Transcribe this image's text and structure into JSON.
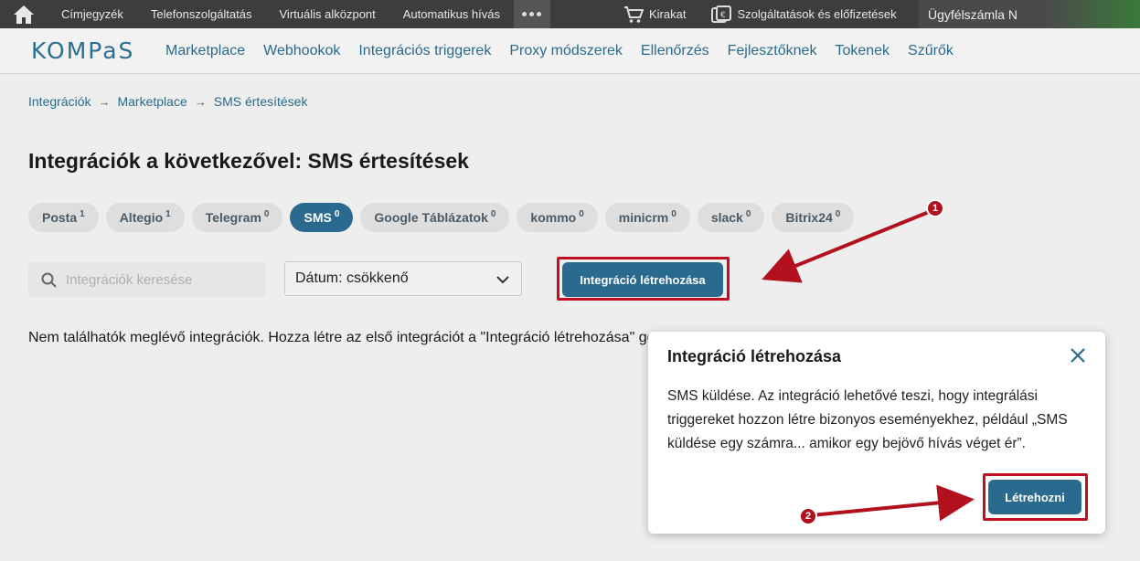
{
  "topbar": {
    "home_icon": "home-icon",
    "items": [
      "Címjegyzék",
      "Telefonszolgáltatás",
      "Virtuális alközpont",
      "Automatikus hívás"
    ],
    "cart_label": "Kirakat",
    "services_label": "Szolgáltatások és előfizetések",
    "account_label": "Ügyfélszámla N"
  },
  "navbar": {
    "logo": "KOMPaS",
    "links": [
      "Marketplace",
      "Webhookok",
      "Integrációs triggerek",
      "Proxy módszerek",
      "Ellenőrzés",
      "Fejlesztőknek",
      "Tokenek",
      "Szűrők"
    ]
  },
  "breadcrumb": [
    "Integrációk",
    "Marketplace",
    "SMS értesítések"
  ],
  "page_title": "Integrációk a következővel: SMS értesítések",
  "chips": [
    {
      "label": "Posta",
      "count": "1"
    },
    {
      "label": "Altegio",
      "count": "1"
    },
    {
      "label": "Telegram",
      "count": "0"
    },
    {
      "label": "SMS",
      "count": "0",
      "active": true
    },
    {
      "label": "Google Táblázatok",
      "count": "0"
    },
    {
      "label": "kommo",
      "count": "0"
    },
    {
      "label": "minicrm",
      "count": "0"
    },
    {
      "label": "slack",
      "count": "0"
    },
    {
      "label": "Bitrix24",
      "count": "0"
    }
  ],
  "search": {
    "placeholder": "Integrációk keresése"
  },
  "sort_select": {
    "value": "Dátum: csökkenő"
  },
  "create_button": "Integráció létrehozása",
  "empty_message": "Nem találhatók meglévő integrációk. Hozza létre az első integrációt a \"Integráció létrehozása\" gombbal.",
  "modal": {
    "title": "Integráció létrehozása",
    "body": "SMS küldése. Az integráció lehetővé teszi, hogy integrálási triggereket hozzon létre bizonyos eseményekhez, például „SMS küldése egy számra... amikor egy bejövő hívás véget ér”.",
    "confirm_button": "Létrehozni"
  },
  "annotations": {
    "badge_1": "1",
    "badge_2": "2",
    "color": "#b3101e"
  },
  "colors": {
    "brand": "#2a6a8f",
    "topbar": "#3d3d3d",
    "highlight": "#c0101f"
  }
}
